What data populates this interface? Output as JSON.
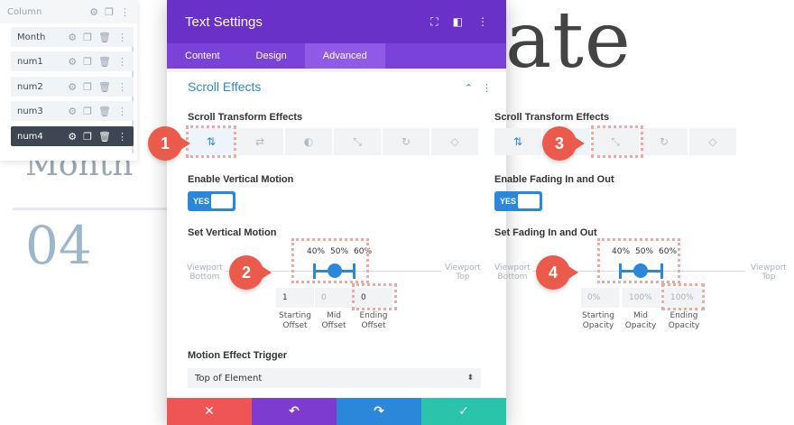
{
  "background": {
    "big_text_top": "ate",
    "big_text_month": "Month",
    "big_text_number": "04"
  },
  "layers": {
    "header_label": "Column",
    "items": [
      {
        "label": "Month"
      },
      {
        "label": "num1"
      },
      {
        "label": "num2"
      },
      {
        "label": "num3"
      },
      {
        "label": "num4"
      }
    ]
  },
  "modal": {
    "title": "Text Settings",
    "tabs": [
      {
        "label": "Content"
      },
      {
        "label": "Design"
      },
      {
        "label": "Advanced"
      }
    ],
    "active_tab": "Advanced",
    "section_title": "Scroll Effects",
    "scroll_transform_label": "Scroll Transform Effects",
    "enable_vertical_label": "Enable Vertical Motion",
    "toggle_yes": "YES",
    "set_vertical_label": "Set Vertical Motion",
    "percents": [
      "40%",
      "50%",
      "60%"
    ],
    "viewport_bottom": [
      "Viewport",
      "Bottom"
    ],
    "viewport_top": [
      "Viewport",
      "Top"
    ],
    "offsets": [
      {
        "value": "1",
        "caption": [
          "Starting",
          "Offset"
        ]
      },
      {
        "value": "0",
        "caption": [
          "Mid",
          "Offset"
        ]
      },
      {
        "value": "0",
        "caption": [
          "Ending",
          "Offset"
        ]
      }
    ],
    "trigger_label": "Motion Effect Trigger",
    "trigger_value": "Top of Element"
  },
  "right": {
    "scroll_transform_label": "Scroll Transform Effects",
    "enable_fading_label": "Enable Fading In and Out",
    "toggle_yes": "YES",
    "set_fading_label": "Set Fading In and Out",
    "percents": [
      "40%",
      "50%",
      "60%"
    ],
    "viewport_bottom": [
      "Viewport",
      "Bottom"
    ],
    "viewport_top": [
      "Viewport",
      "Top"
    ],
    "opacities": [
      {
        "value": "0%",
        "caption": [
          "Starting",
          "Opacity"
        ]
      },
      {
        "value": "100%",
        "caption": [
          "Mid",
          "Opacity"
        ]
      },
      {
        "value": "100%",
        "caption": [
          "Ending",
          "Opacity"
        ]
      }
    ]
  },
  "badges": [
    "1",
    "2",
    "3",
    "4"
  ],
  "colors": {
    "header": "#6a31c8",
    "accent": "#2b87da",
    "badge": "#ea5b4c",
    "highlight": "#f2a7a0"
  }
}
